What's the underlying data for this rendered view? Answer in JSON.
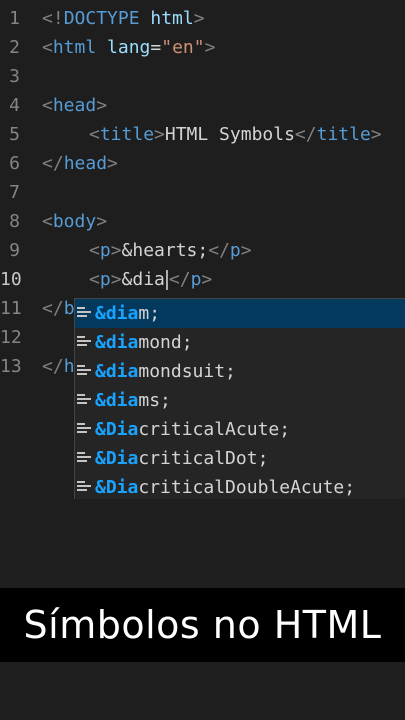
{
  "editor": {
    "lines": [
      {
        "num": "1",
        "parts": [
          {
            "t": "<!",
            "c": "br"
          },
          {
            "t": "DOCTYPE",
            "c": "tag"
          },
          {
            "t": " html",
            "c": "attr"
          },
          {
            "t": ">",
            "c": "br"
          }
        ]
      },
      {
        "num": "2",
        "parts": [
          {
            "t": "<",
            "c": "br"
          },
          {
            "t": "html",
            "c": "tag"
          },
          {
            "t": " lang",
            "c": "attr"
          },
          {
            "t": "=",
            "c": "txt"
          },
          {
            "t": "\"en\"",
            "c": "str"
          },
          {
            "t": ">",
            "c": "br"
          }
        ]
      },
      {
        "num": "3",
        "parts": []
      },
      {
        "num": "4",
        "parts": [
          {
            "t": "<",
            "c": "br"
          },
          {
            "t": "head",
            "c": "tag"
          },
          {
            "t": ">",
            "c": "br"
          }
        ]
      },
      {
        "num": "5",
        "indent": true,
        "parts": [
          {
            "t": "<",
            "c": "br"
          },
          {
            "t": "title",
            "c": "tag"
          },
          {
            "t": ">",
            "c": "br"
          },
          {
            "t": "HTML Symbols",
            "c": "txt"
          },
          {
            "t": "</",
            "c": "br"
          },
          {
            "t": "title",
            "c": "tag"
          },
          {
            "t": ">",
            "c": "br"
          }
        ]
      },
      {
        "num": "6",
        "parts": [
          {
            "t": "</",
            "c": "br"
          },
          {
            "t": "head",
            "c": "tag"
          },
          {
            "t": ">",
            "c": "br"
          }
        ]
      },
      {
        "num": "7",
        "parts": []
      },
      {
        "num": "8",
        "parts": [
          {
            "t": "<",
            "c": "br"
          },
          {
            "t": "body",
            "c": "tag"
          },
          {
            "t": ">",
            "c": "br"
          }
        ]
      },
      {
        "num": "9",
        "indent": true,
        "parts": [
          {
            "t": "<",
            "c": "br"
          },
          {
            "t": "p",
            "c": "tag"
          },
          {
            "t": ">",
            "c": "br"
          },
          {
            "t": "&hearts;",
            "c": "txt"
          },
          {
            "t": "</",
            "c": "br"
          },
          {
            "t": "p",
            "c": "tag"
          },
          {
            "t": ">",
            "c": "br"
          }
        ]
      },
      {
        "num": "10",
        "indent": true,
        "active": true,
        "parts": [
          {
            "t": "<",
            "c": "br"
          },
          {
            "t": "p",
            "c": "tag"
          },
          {
            "t": ">",
            "c": "br"
          },
          {
            "t": "&dia",
            "c": "txt"
          },
          {
            "t": "CARET",
            "c": "caret"
          },
          {
            "t": "</",
            "c": "br"
          },
          {
            "t": "p",
            "c": "tag"
          },
          {
            "t": ">",
            "c": "br"
          }
        ]
      },
      {
        "num": "11",
        "parts": [
          {
            "t": "</",
            "c": "br"
          },
          {
            "t": "b",
            "c": "tag"
          }
        ]
      },
      {
        "num": "12",
        "parts": []
      },
      {
        "num": "13",
        "parts": [
          {
            "t": "</",
            "c": "br"
          },
          {
            "t": "h",
            "c": "tag"
          }
        ]
      }
    ]
  },
  "suggestions": {
    "items": [
      {
        "match": "&dia",
        "rest": "m;",
        "selected": true
      },
      {
        "match": "&dia",
        "rest": "mond;"
      },
      {
        "match": "&dia",
        "rest": "mondsuit;"
      },
      {
        "match": "&dia",
        "rest": "ms;"
      },
      {
        "match": "&Dia",
        "rest": "criticalAcute;"
      },
      {
        "match": "&Dia",
        "rest": "criticalDot;"
      },
      {
        "match": "&Dia",
        "rest": "criticalDoubleAcute;"
      }
    ]
  },
  "caption": {
    "text": "Símbolos no HTML"
  },
  "colors": {
    "tag": "#569cd6",
    "bracket": "#808080",
    "string": "#ce9178",
    "match": "#18a3ff",
    "selection": "#04395e"
  }
}
